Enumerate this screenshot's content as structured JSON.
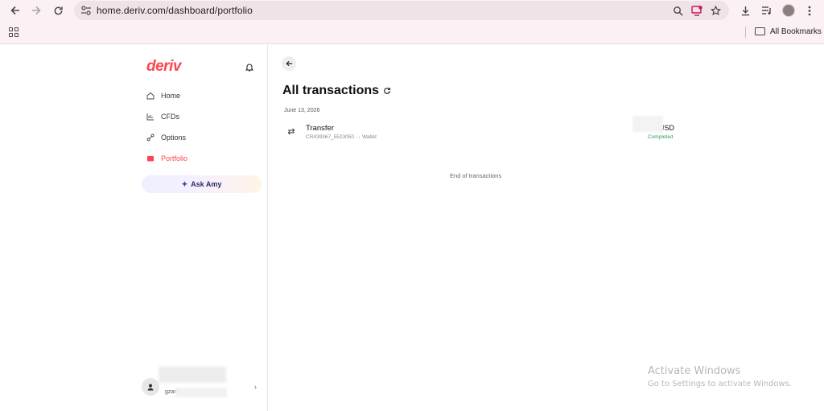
{
  "browser": {
    "url": "home.deriv.com/dashboard/portfolio",
    "bookmarks_label": "All Bookmarks"
  },
  "sidebar": {
    "logo": "deriv",
    "items": [
      {
        "label": "Home",
        "icon": "home-icon"
      },
      {
        "label": "CFDs",
        "icon": "chart-icon"
      },
      {
        "label": "Options",
        "icon": "options-icon"
      },
      {
        "label": "Portfolio",
        "icon": "portfolio-icon",
        "active": true
      }
    ],
    "ask_amy": "Ask Amy",
    "user_email": "gzamb....@gmail.com"
  },
  "main": {
    "title": "All transactions",
    "groups": [
      {
        "date": "June 13, 2026",
        "transactions": [
          {
            "title": "Transfer",
            "subtitle": "CR439367_5523050 → Wallet",
            "amount": "0.00 USD",
            "status": "Completed"
          }
        ]
      }
    ],
    "end_text": "End of transactions"
  },
  "overlay": {
    "title": "Activate Windows",
    "subtitle": "Go to Settings to activate Windows."
  },
  "colors": {
    "brand": "#ff444f",
    "status_completed": "#2e9e55",
    "chrome_bg": "#fbf1f4"
  }
}
